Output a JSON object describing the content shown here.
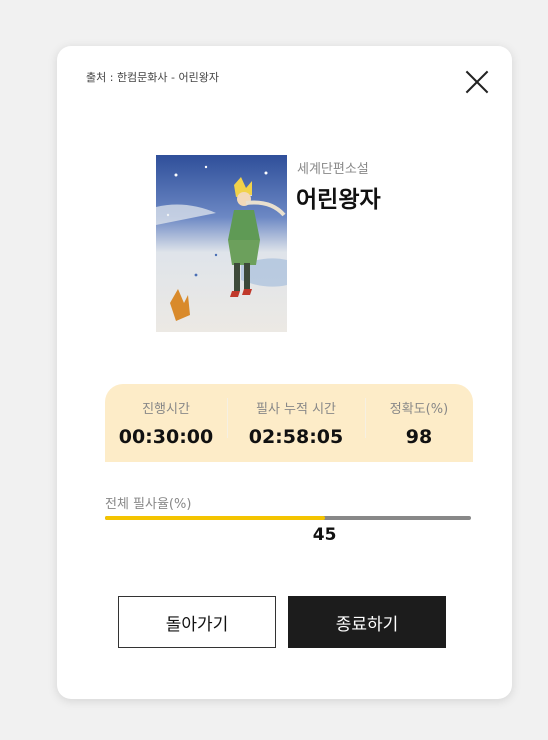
{
  "modal": {
    "source": "출처 : 한컴문화사 - 어린왕자",
    "close_icon": "close-icon"
  },
  "book": {
    "category": "세계단편소설",
    "title": "어린왕자"
  },
  "stats": [
    {
      "label": "진행시간",
      "value": "00:30:00"
    },
    {
      "label": "필사 누적 시간",
      "value": "02:58:05"
    },
    {
      "label": "정확도(%)",
      "value": "98"
    }
  ],
  "progress": {
    "label": "전체 필사율(%)",
    "value": "45",
    "percent": 60,
    "colors": {
      "fill": "#f4c400",
      "track": "#888888"
    }
  },
  "buttons": {
    "back": "돌아가기",
    "end": "종료하기"
  }
}
